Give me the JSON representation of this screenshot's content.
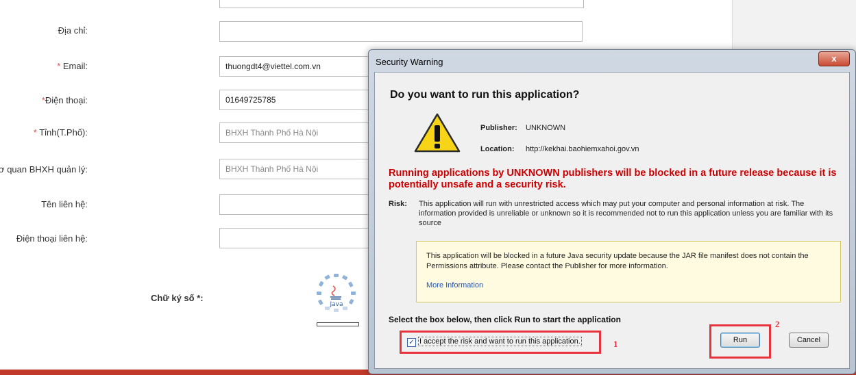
{
  "form": {
    "address_label": "Địa chỉ:",
    "address_value": "",
    "email_label": "Email:",
    "email_value": "thuongdt4@viettel.com.vn",
    "phone_label": "Điện thoại:",
    "phone_value": "01649725785",
    "province_label": "Tỉnh(T.Phố):",
    "province_value": "BHXH Thành Phố Hà Nội",
    "agency_label": "Cơ quan BHXH quản lý:",
    "agency_value": "BHXH Thành Phố Hà Nội",
    "contact_name_label": "Tên liên hệ:",
    "contact_name_value": "",
    "contact_phone_label": "Điện thoại liên hệ:",
    "contact_phone_value": "",
    "signature_label": "Chữ ký số *:",
    "required_mark": "*",
    "java_text": "Java"
  },
  "dialog": {
    "title": "Security Warning",
    "close_glyph": "x",
    "question": "Do you want to run this application?",
    "publisher_label": "Publisher:",
    "publisher_value": "UNKNOWN",
    "location_label": "Location:",
    "location_value": "http://kekhai.baohiemxahoi.gov.vn",
    "danger_text": "Running applications by UNKNOWN publishers will be blocked in a future release because it is potentially unsafe and a security risk.",
    "risk_label": "Risk:",
    "risk_text": "This application will run with unrestricted access which may put your computer and personal information at risk. The information provided is unreliable or unknown so it is recommended not to run this application unless you are familiar with its source",
    "notice_text": "This application will be blocked in a future Java security update because the JAR file manifest does not contain the Permissions attribute. Please contact the Publisher for more information.",
    "more_info": "More Information",
    "instruction": "Select the box below, then click Run to start the application",
    "accept_label": "I accept the risk and want to run this application.",
    "accept_checked": true,
    "run_label": "Run",
    "cancel_label": "Cancel",
    "step1": "1",
    "step2": "2"
  },
  "colors": {
    "accent_red": "#e8323c",
    "danger_red": "#cc0000",
    "link_blue": "#2255bb",
    "notice_bg": "#fffbe0"
  },
  "icons": [
    "warning-icon",
    "java-logo-icon",
    "close-icon",
    "checkbox-icon"
  ]
}
